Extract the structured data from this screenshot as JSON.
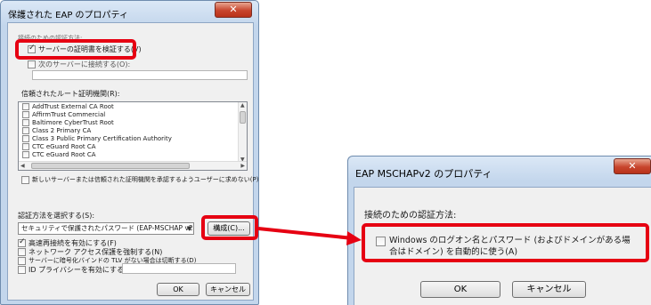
{
  "colors": {
    "highlight": "#e60012",
    "title_bar": "#c3d6ec",
    "client_bg": "#f0f0f0",
    "close_button": "#c8452d"
  },
  "left_dialog": {
    "title": "保護された EAP のプロパティ",
    "close_icon": "close-icon",
    "connect_section_label": "接続のための認証方法:",
    "verify_server_cert": {
      "label": "サーバーの証明書を検証する(V)",
      "checked": true
    },
    "connect_servers": {
      "label": "次のサーバーに接続する(O):",
      "checked": false,
      "value": ""
    },
    "root_ca_label": "信頼されたルート証明機関(R):",
    "root_ca_list": [
      "AddTrust External CA Root",
      "AffirmTrust Commercial",
      "Baltimore CyberTrust Root",
      "Class 2 Primary CA",
      "Class 3 Public Primary Certification Authority",
      "CTC eGuard Root CA",
      "CTC eGuard Root CA"
    ],
    "no_prompt": {
      "label": "新しいサーバーまたは信頼された証明機関を承認するようユーザーに求めない(P)",
      "checked": false
    },
    "auth_method_label": "認証方法を選択する(S):",
    "auth_method_value": "セキュリティで保護されたパスワード (EAP-MSCHAP v2)",
    "configure_button": "構成(C)...",
    "fast_reconnect": {
      "label": "高速再接続を有効にする(F)",
      "checked": true
    },
    "nap": {
      "label": "ネットワーク アクセス保護を強制する(N)",
      "checked": false
    },
    "tlv_disconnect": {
      "label": "サーバーに暗号化バインドの TLV がない場合は切断する(D)",
      "checked": false
    },
    "identity_privacy": {
      "label": "ID プライバシーを有効にする(I)",
      "checked": false,
      "value": ""
    },
    "ok_button": "OK",
    "cancel_button": "キャンセル"
  },
  "right_dialog": {
    "title": "EAP MSCHAPv2 のプロパティ",
    "close_icon": "close-icon",
    "section_label": "接続のための認証方法:",
    "auto_logon": {
      "label_line1": "Windows のログオン名とパスワード (およびドメインがある場",
      "label_line2": "合はドメイン) を自動的に使う(A)",
      "checked": false
    },
    "ok_button": "OK",
    "cancel_button": "キャンセル"
  }
}
